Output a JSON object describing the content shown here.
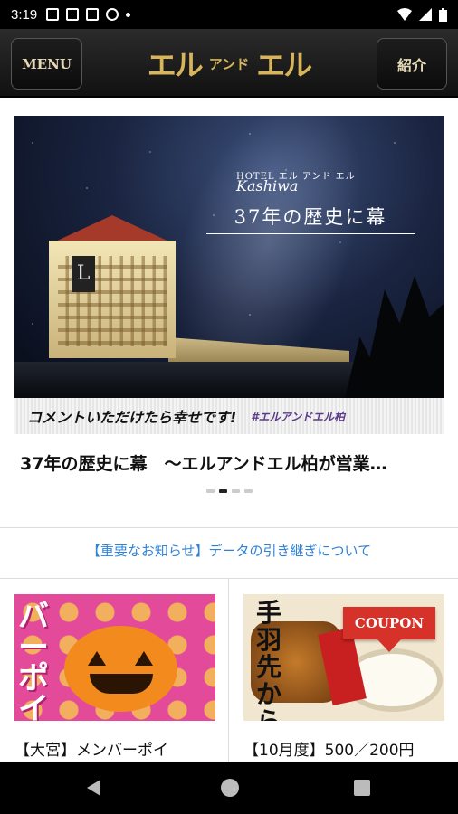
{
  "status_bar": {
    "time": "3:19"
  },
  "app_bar": {
    "menu_label": "MENU",
    "logo_big_left": "エル",
    "logo_small": "アンド",
    "logo_big_right": "エル",
    "intro_label": "紹介"
  },
  "banner": {
    "hotel_label": "HOTEL エル アンド エル",
    "hotel_location": "Kashiwa",
    "headline": "37年の歴史に幕",
    "caption": "コメントいただけたら幸せです!",
    "hashtag": "#エルアンドエル柏"
  },
  "slide_title": "37年の歴史に幕　～エルアンドエル柏が営業…",
  "pager": {
    "count": 4,
    "active": 1
  },
  "notice": "【重要なお知らせ】データの引き継ぎについて",
  "cards": [
    {
      "label": "【大宮】メンバーポイ",
      "image_text": "バーポイン"
    },
    {
      "label": "【10月度】500／200円",
      "image_text": "手羽先から揚げ",
      "badge": "COUPON"
    }
  ],
  "colors": {
    "accent_gold": "#d8b45a",
    "notice_blue": "#2f83d6",
    "coupon_red": "#d6322a"
  }
}
